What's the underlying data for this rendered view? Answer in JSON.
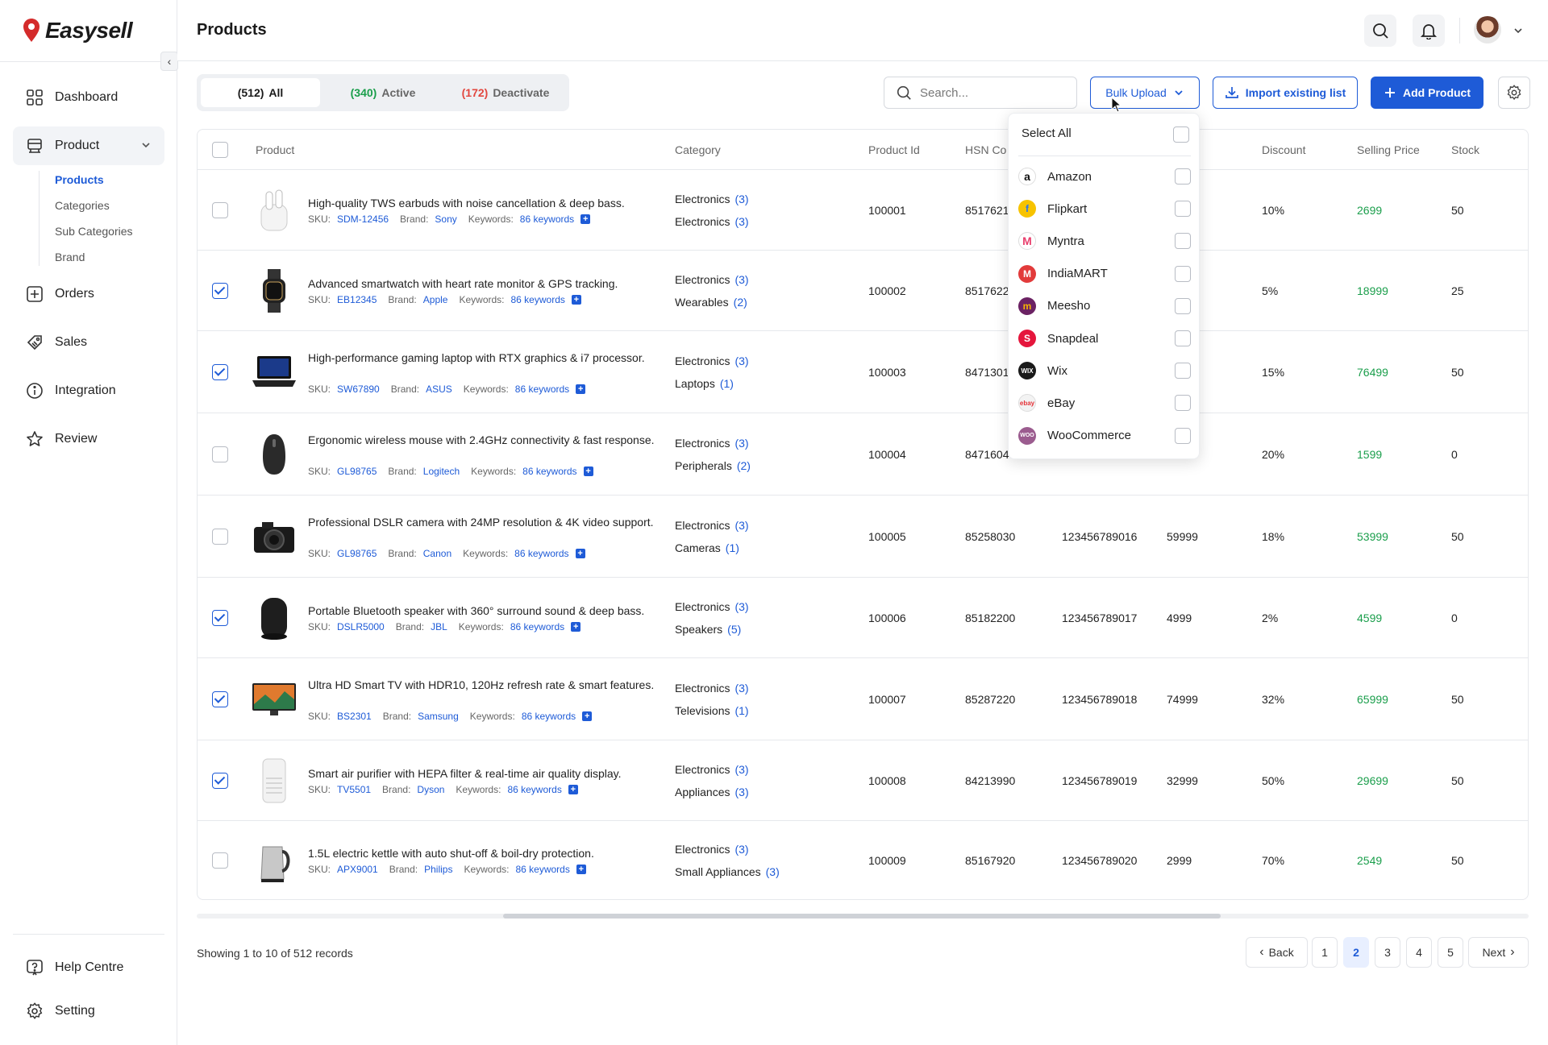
{
  "brand": {
    "name": "Easysell"
  },
  "sidebar": {
    "items": [
      {
        "label": "Dashboard"
      },
      {
        "label": "Product"
      },
      {
        "label": "Orders"
      },
      {
        "label": "Sales"
      },
      {
        "label": "Integration"
      },
      {
        "label": "Review"
      }
    ],
    "sub_items": [
      {
        "label": "Products"
      },
      {
        "label": "Categories"
      },
      {
        "label": "Sub Categories"
      },
      {
        "label": "Brand"
      }
    ],
    "bottom": [
      {
        "label": "Help Centre"
      },
      {
        "label": "Setting"
      }
    ]
  },
  "header": {
    "title": "Products"
  },
  "tabs": [
    {
      "count": "(512)",
      "label": "All"
    },
    {
      "count": "(340)",
      "label": "Active"
    },
    {
      "count": "(172)",
      "label": "Deactivate"
    }
  ],
  "toolbar": {
    "search_placeholder": "Search...",
    "bulk_upload": "Bulk Upload",
    "import_label": "Import existing list",
    "add_label": "Add Product"
  },
  "table": {
    "headers": [
      "Product",
      "Category",
      "Product Id",
      "HSN Co",
      "Discount",
      "Selling Price",
      "Stock"
    ],
    "sku_label": "SKU:",
    "brand_label": "Brand:",
    "keywords_label": "Keywords:",
    "rows": [
      {
        "name": "High-quality TWS earbuds with noise cancellation & deep bass.",
        "sku": "SDM-12456",
        "brand": "Sony",
        "keywords": "86 keywords",
        "cat1": "Electronics",
        "cat1n": "(3)",
        "cat2": "Electronics",
        "cat2n": "(3)",
        "pid": "100001",
        "hsn": "85176210",
        "gtin": "",
        "mrp": "",
        "discount": "10%",
        "price": "2699",
        "stock": "50"
      },
      {
        "name": "Advanced smartwatch with heart rate monitor & GPS tracking.",
        "sku": "EB12345",
        "brand": "Apple",
        "keywords": "86 keywords",
        "cat1": "Electronics",
        "cat1n": "(3)",
        "cat2": "Wearables",
        "cat2n": "(2)",
        "pid": "100002",
        "hsn": "85176220",
        "gtin": "",
        "mrp": "",
        "discount": "5%",
        "price": "18999",
        "stock": "25"
      },
      {
        "name": "High-performance gaming laptop with RTX graphics & i7 processor.",
        "sku": "SW67890",
        "brand": "ASUS",
        "keywords": "86 keywords",
        "cat1": "Electronics",
        "cat1n": "(3)",
        "cat2": "Laptops",
        "cat2n": "(1)",
        "pid": "100003",
        "hsn": "84713010",
        "gtin": "",
        "mrp": "",
        "discount": "15%",
        "price": "76499",
        "stock": "50"
      },
      {
        "name": "Ergonomic wireless mouse with 2.4GHz connectivity & fast response.",
        "sku": "GL98765",
        "brand": "Logitech",
        "keywords": "86 keywords",
        "cat1": "Electronics",
        "cat1n": "(3)",
        "cat2": "Peripherals",
        "cat2n": "(2)",
        "pid": "100004",
        "hsn": "84716040",
        "gtin": "",
        "mrp": "",
        "discount": "20%",
        "price": "1599",
        "stock": "0"
      },
      {
        "name": "Professional DSLR camera with 24MP resolution & 4K video support.",
        "sku": "GL98765",
        "brand": "Canon",
        "keywords": "86 keywords",
        "cat1": "Electronics",
        "cat1n": "(3)",
        "cat2": "Cameras",
        "cat2n": "(1)",
        "pid": "100005",
        "hsn": "85258030",
        "gtin": "123456789016",
        "mrp": "59999",
        "discount": "18%",
        "price": "53999",
        "stock": "50"
      },
      {
        "name": "Portable Bluetooth speaker with 360° surround sound & deep bass.",
        "sku": "DSLR5000",
        "brand": "JBL",
        "keywords": "86 keywords",
        "cat1": "Electronics",
        "cat1n": "(3)",
        "cat2": "Speakers",
        "cat2n": "(5)",
        "pid": "100006",
        "hsn": "85182200",
        "gtin": "123456789017",
        "mrp": "4999",
        "discount": "2%",
        "price": "4599",
        "stock": "0"
      },
      {
        "name": "Ultra HD Smart TV with HDR10, 120Hz refresh rate & smart features.",
        "sku": "BS2301",
        "brand": "Samsung",
        "keywords": "86 keywords",
        "cat1": "Electronics",
        "cat1n": "(3)",
        "cat2": "Televisions",
        "cat2n": "(1)",
        "pid": "100007",
        "hsn": "85287220",
        "gtin": "123456789018",
        "mrp": "74999",
        "discount": "32%",
        "price": "65999",
        "stock": "50"
      },
      {
        "name": "Smart air purifier with HEPA filter & real-time air quality display.",
        "sku": "TV5501",
        "brand": "Dyson",
        "keywords": "86 keywords",
        "cat1": "Electronics",
        "cat1n": "(3)",
        "cat2": "Appliances",
        "cat2n": "(3)",
        "pid": "100008",
        "hsn": "84213990",
        "gtin": "123456789019",
        "mrp": "32999",
        "discount": "50%",
        "price": "29699",
        "stock": "50"
      },
      {
        "name": "1.5L electric kettle with auto shut-off & boil-dry protection.",
        "sku": "APX9001",
        "brand": "Philips",
        "keywords": "86 keywords",
        "cat1": "Electronics",
        "cat1n": "(3)",
        "cat2": "Small Appliances",
        "cat2n": "(3)",
        "pid": "100009",
        "hsn": "85167920",
        "gtin": "123456789020",
        "mrp": "2999",
        "discount": "70%",
        "price": "2549",
        "stock": "50"
      }
    ]
  },
  "dropdown": {
    "select_all": "Select All",
    "items": [
      {
        "label": "Amazon",
        "icon": "amazon-icon",
        "color": "#ffffff"
      },
      {
        "label": "Flipkart",
        "icon": "flipkart-icon",
        "color": "#f7c300"
      },
      {
        "label": "Myntra",
        "icon": "myntra-icon",
        "color": "#ffffff"
      },
      {
        "label": "IndiaMART",
        "icon": "indiamart-icon",
        "color": "#e23b3b"
      },
      {
        "label": "Meesho",
        "icon": "meesho-icon",
        "color": "#6b2263"
      },
      {
        "label": "Snapdeal",
        "icon": "snapdeal-icon",
        "color": "#e5163c"
      },
      {
        "label": "Wix",
        "icon": "wix-icon",
        "color": "#1a1a1a"
      },
      {
        "label": "eBay",
        "icon": "ebay-icon",
        "color": "#f3f3f3"
      },
      {
        "label": "WooCommerce",
        "icon": "woocommerce-icon",
        "color": "#9b5c8f"
      }
    ]
  },
  "footer": {
    "showing": "Showing 1 to 10 of 512 records",
    "back": "Back",
    "next": "Next",
    "pages": [
      "1",
      "2",
      "3",
      "4",
      "5"
    ]
  },
  "colors": {
    "accent": "#1e5bd7",
    "green": "#1a9e4b",
    "red": "#e2473f"
  }
}
